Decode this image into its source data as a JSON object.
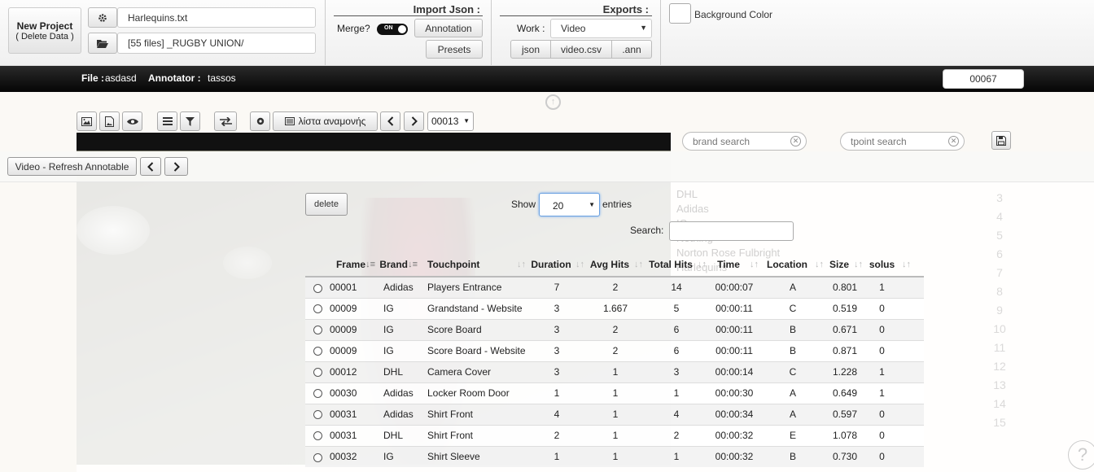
{
  "top": {
    "new_project": "New Project",
    "new_project_sub": "( Delete Data )",
    "config_file": "Harlequins.txt",
    "folder": "[55 files]  _RUGBY UNION/",
    "import_title": "Import Json :",
    "merge_label": "Merge?",
    "toggle_text": "ON",
    "annotation_btn": "Annotation",
    "presets_btn": "Presets",
    "exports_title": "Exports :",
    "work_label": "Work :",
    "work_value": "Video",
    "export_json": "json",
    "export_csv": "video.csv",
    "export_ann": ".ann",
    "bg_color_label": "Background Color"
  },
  "infobar": {
    "file_label": "File :",
    "file_value": "asdasd",
    "annotator_label": "Annotator :",
    "annotator_value": "tassos",
    "frame_counter": "00067"
  },
  "toolbar": {
    "waitlist": "λίστα αναμονής",
    "frame_select": "00013",
    "brand_placeholder": "brand search",
    "tpoint_placeholder": "tpoint search"
  },
  "refresh": {
    "label": "Video - Refresh Annotable"
  },
  "table_controls": {
    "delete": "delete",
    "show": "Show",
    "entries_value": "20",
    "entries": "entries",
    "search": "Search:"
  },
  "ghost_brands": [
    "DHL",
    "Adidas",
    "IG",
    "Nothing",
    "Norton Rose Fulbright",
    "Harlequins"
  ],
  "ghost_numbers": [
    "3",
    "4",
    "5",
    "6",
    "7",
    "8",
    "9",
    "10",
    "11",
    "12",
    "13",
    "14",
    "15"
  ],
  "table": {
    "headers": [
      "Frame",
      "Brand",
      "Touchpoint",
      "Duration",
      "Avg Hits",
      "Total Hits",
      "Time",
      "Location",
      "Size",
      "solus"
    ],
    "rows": [
      [
        "00001",
        "Adidas",
        "Players Entrance",
        "7",
        "2",
        "14",
        "00:00:07",
        "A",
        "0.801",
        "1"
      ],
      [
        "00009",
        "IG",
        "Grandstand - Website",
        "3",
        "1.667",
        "5",
        "00:00:11",
        "C",
        "0.519",
        "0"
      ],
      [
        "00009",
        "IG",
        "Score Board",
        "3",
        "2",
        "6",
        "00:00:11",
        "B",
        "0.671",
        "0"
      ],
      [
        "00009",
        "IG",
        "Score Board - Website",
        "3",
        "2",
        "6",
        "00:00:11",
        "B",
        "0.871",
        "0"
      ],
      [
        "00012",
        "DHL",
        "Camera Cover",
        "3",
        "1",
        "3",
        "00:00:14",
        "C",
        "1.228",
        "1"
      ],
      [
        "00030",
        "Adidas",
        "Locker Room Door",
        "1",
        "1",
        "1",
        "00:00:30",
        "A",
        "0.649",
        "1"
      ],
      [
        "00031",
        "Adidas",
        "Shirt Front",
        "4",
        "1",
        "4",
        "00:00:34",
        "A",
        "0.597",
        "0"
      ],
      [
        "00031",
        "DHL",
        "Shirt Front",
        "2",
        "1",
        "2",
        "00:00:32",
        "E",
        "1.078",
        "0"
      ],
      [
        "00032",
        "IG",
        "Shirt Sleeve",
        "1",
        "1",
        "1",
        "00:00:32",
        "B",
        "0.730",
        "0"
      ]
    ]
  }
}
